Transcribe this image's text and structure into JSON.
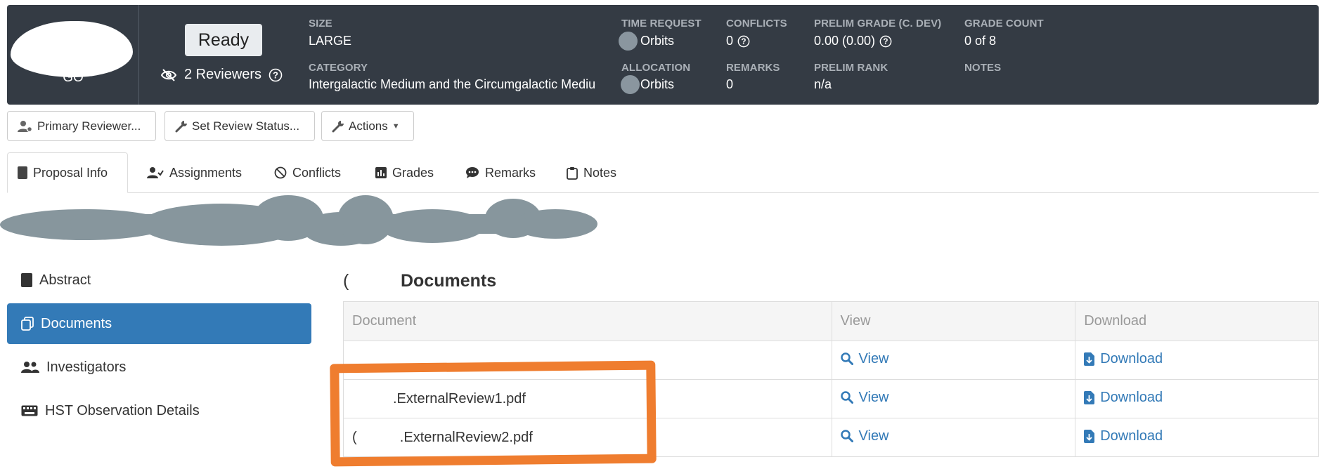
{
  "header": {
    "program_type": "GO",
    "status_button": "Ready",
    "reviewers": "2 Reviewers",
    "fields": {
      "size_label": "SIZE",
      "size_value": "LARGE",
      "category_label": "CATEGORY",
      "category_value": "Intergalactic Medium and the Circumgalactic Mediu",
      "time_request_label": "TIME REQUEST",
      "time_request_value": "Orbits",
      "allocation_label": "ALLOCATION",
      "allocation_value": "Orbits",
      "conflicts_label": "CONFLICTS",
      "conflicts_value": "0",
      "remarks_label": "REMARKS",
      "remarks_value": "0",
      "prelim_grade_label": "PRELIM GRADE (C. DEV)",
      "prelim_grade_value": "0.00 (0.00)",
      "prelim_rank_label": "PRELIM RANK",
      "prelim_rank_value": "n/a",
      "grade_count_label": "GRADE COUNT",
      "grade_count_value": "0 of 8",
      "notes_label": "NOTES"
    },
    "colors": {
      "bg": "#343b44",
      "label": "#aab0b7"
    }
  },
  "actions": {
    "primary_reviewer": "Primary Reviewer...",
    "set_review_status": "Set Review Status...",
    "actions": "Actions"
  },
  "tabs": [
    "Proposal Info",
    "Assignments",
    "Conflicts",
    "Grades",
    "Remarks",
    "Notes"
  ],
  "sidebar": {
    "items": [
      "Abstract",
      "Documents",
      "Investigators",
      "HST Observation Details"
    ],
    "active_color": "#337ab7"
  },
  "documents": {
    "title": "Documents",
    "title_prefix": "(",
    "columns": [
      "Document",
      "View",
      "Download"
    ],
    "rows": [
      {
        "document": "",
        "view": "View",
        "download": "Download"
      },
      {
        "document": ".ExternalReview1.pdf",
        "view": "View",
        "download": "Download"
      },
      {
        "document": ".ExternalReview2.pdf",
        "view": "View",
        "download": "Download"
      }
    ],
    "row_prefix_3": "(",
    "link_color": "#337ab7"
  },
  "annotation": {
    "highlight_color": "#ef7d2f"
  }
}
